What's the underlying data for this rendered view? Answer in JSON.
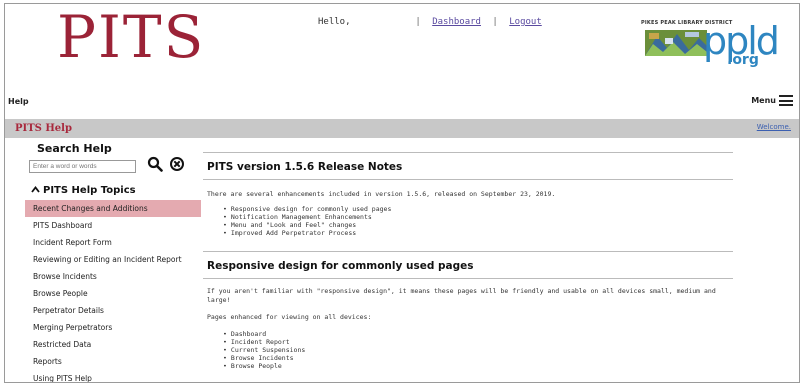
{
  "header": {
    "logo": "PITS",
    "greeting": "Hello,",
    "dashboard_link": "Dashboard",
    "logout_link": "Logout",
    "separator": "|",
    "library_name": "PIKES PEAK LIBRARY DISTRICT",
    "library_wordmark": "ppld",
    "library_tld": ".org"
  },
  "subheader": {
    "help_label": "Help",
    "menu_label": "Menu"
  },
  "titlebar": {
    "title": "PITS Help",
    "welcome_link": "Welcome."
  },
  "sidebar": {
    "title": "Search Help",
    "search_placeholder": "Enter a word or words",
    "topics_heading": "PITS Help Topics",
    "topics_caret": "^",
    "items": [
      {
        "label": "Recent Changes and Additions",
        "active": true
      },
      {
        "label": "PITS Dashboard"
      },
      {
        "label": "Incident Report Form"
      },
      {
        "label": "Reviewing or Editing an Incident Report"
      },
      {
        "label": "Browse Incidents"
      },
      {
        "label": "Browse People"
      },
      {
        "label": "Perpetrator Details"
      },
      {
        "label": "Merging Perpetrators"
      },
      {
        "label": "Restricted Data"
      },
      {
        "label": "Reports"
      },
      {
        "label": "Using PITS Help"
      }
    ]
  },
  "content": {
    "release_title": "PITS version 1.5.6 Release Notes",
    "intro": "There are several enhancements included in version 1.5.6, released on September 23, 2019.",
    "enhancements": [
      "Responsive design for commonly used pages",
      "Notification Management Enhancements",
      "Menu and \"Look and Feel\" changes",
      "Improved Add Perpetrator Process"
    ],
    "section_title": "Responsive design for commonly used pages",
    "section_p1": "If you aren't familiar with \"responsive design\", it means these pages will be friendly and usable on all devices small, medium and large!",
    "section_p2": "Pages enhanced for viewing on all devices:",
    "pages": [
      "Dashboard",
      "Incident Report",
      "Current Suspensions",
      "Browse Incidents",
      "Browse People"
    ]
  },
  "colors": {
    "logo": "#9b2337",
    "titlebar_bg": "#c8c8c8",
    "active_topic": "#e4aab0",
    "link": "#5a4aa0",
    "ppld_blue": "#2e86c1"
  }
}
